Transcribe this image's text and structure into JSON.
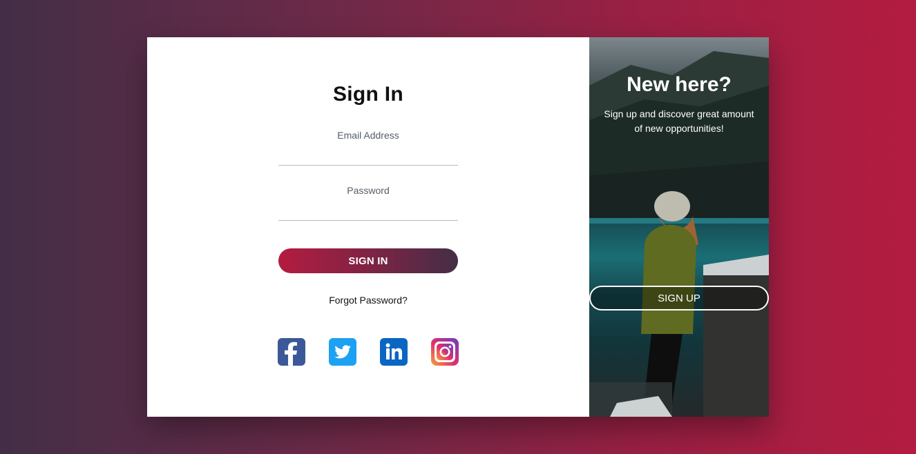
{
  "signin": {
    "title": "Sign In",
    "email_label": "Email Address",
    "email_value": "",
    "password_label": "Password",
    "password_value": "",
    "submit_label": "SIGN IN",
    "forgot_label": "Forgot Password?"
  },
  "social": [
    {
      "name": "facebook-icon",
      "color": "#3b5998"
    },
    {
      "name": "twitter-icon",
      "color": "#1da1f2"
    },
    {
      "name": "linkedin-icon",
      "color": "#0a66c2"
    },
    {
      "name": "instagram-icon",
      "color": "#c13584"
    }
  ],
  "signup": {
    "title": "New here?",
    "text": "Sign up and discover great amount of new opportunities!",
    "button_label": "SIGN UP"
  },
  "colors": {
    "accent": "#b31c40",
    "gradient_dark": "#432e47"
  }
}
